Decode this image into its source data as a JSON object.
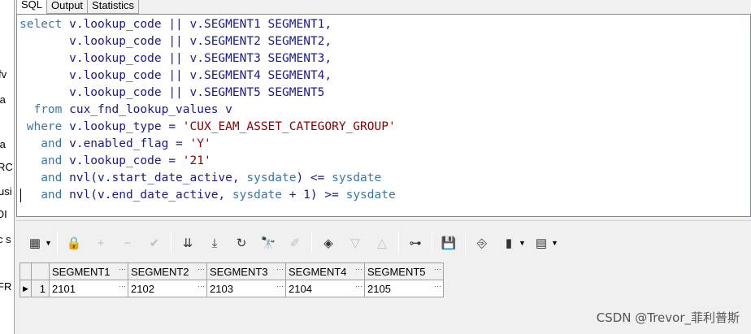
{
  "tabs": [
    {
      "label": "SQL",
      "active": true
    },
    {
      "label": "Output",
      "active": false
    },
    {
      "label": "Statistics",
      "active": false
    }
  ],
  "left_fragments": [
    "fv",
    "ta",
    "ta",
    "RC",
    "usi",
    "OI",
    "c s",
    "FR"
  ],
  "sql": {
    "lines": [
      [
        {
          "t": "select ",
          "c": "kw"
        },
        {
          "t": "v.lookup_code || v.SEGMENT1 SEGMENT1,",
          "c": "id"
        }
      ],
      [
        {
          "t": "       v.lookup_code || v.SEGMENT2 SEGMENT2,",
          "c": "id"
        }
      ],
      [
        {
          "t": "       v.lookup_code || v.SEGMENT3 SEGMENT3,",
          "c": "id"
        }
      ],
      [
        {
          "t": "       v.lookup_code || v.SEGMENT4 SEGMENT4,",
          "c": "id"
        }
      ],
      [
        {
          "t": "       v.lookup_code || v.SEGMENT5 SEGMENT5",
          "c": "id"
        }
      ],
      [
        {
          "t": "  from ",
          "c": "kw"
        },
        {
          "t": "cux_fnd_lookup_values v",
          "c": "id"
        }
      ],
      [
        {
          "t": " where ",
          "c": "kw"
        },
        {
          "t": "v.lookup_type = ",
          "c": "id"
        },
        {
          "t": "'CUX_EAM_ASSET_CATEGORY_GROUP'",
          "c": "str"
        }
      ],
      [
        {
          "t": "   and ",
          "c": "kw"
        },
        {
          "t": "v.enabled_flag = ",
          "c": "id"
        },
        {
          "t": "'Y'",
          "c": "str"
        }
      ],
      [
        {
          "t": "   and ",
          "c": "kw"
        },
        {
          "t": "v.lookup_code = ",
          "c": "id"
        },
        {
          "t": "'21'",
          "c": "str"
        }
      ],
      [
        {
          "t": "   and ",
          "c": "kw"
        },
        {
          "t": "nvl(v.start_date_active, ",
          "c": "id"
        },
        {
          "t": "sysdate",
          "c": "kw"
        },
        {
          "t": ") <= ",
          "c": "id"
        },
        {
          "t": "sysdate",
          "c": "kw"
        }
      ],
      [
        {
          "t": "   and ",
          "c": "kw"
        },
        {
          "t": "nvl(v.end_date_active, ",
          "c": "id"
        },
        {
          "t": "sysdate",
          "c": "kw"
        },
        {
          "t": " + 1) >= ",
          "c": "id"
        },
        {
          "t": "sysdate",
          "c": "kw"
        }
      ]
    ]
  },
  "toolbar": {
    "icons": [
      {
        "name": "grid-view-icon",
        "glyph": "▦",
        "disabled": false,
        "caret": true
      },
      {
        "sep": true
      },
      {
        "name": "lock-icon",
        "glyph": "🔒",
        "disabled": false
      },
      {
        "name": "add-row-icon",
        "glyph": "+",
        "disabled": true
      },
      {
        "name": "delete-row-icon",
        "glyph": "−",
        "disabled": true
      },
      {
        "name": "post-changes-icon",
        "glyph": "✔",
        "disabled": true
      },
      {
        "sep": true
      },
      {
        "name": "fetch-next-icon",
        "glyph": "⇊",
        "disabled": false
      },
      {
        "name": "fetch-last-icon",
        "glyph": "⤓",
        "disabled": false
      },
      {
        "name": "refresh-icon",
        "glyph": "↻",
        "disabled": false
      },
      {
        "name": "binoculars-icon",
        "glyph": "🔭",
        "disabled": false
      },
      {
        "name": "eraser-icon",
        "glyph": "✐",
        "disabled": true
      },
      {
        "sep": true
      },
      {
        "name": "query-by-example-icon",
        "glyph": "◈",
        "disabled": false
      },
      {
        "name": "sort-down-icon",
        "glyph": "▽",
        "disabled": true
      },
      {
        "name": "sort-up-icon",
        "glyph": "△",
        "disabled": true
      },
      {
        "sep": true
      },
      {
        "name": "tree-icon",
        "glyph": "⊶",
        "disabled": false
      },
      {
        "sep": true
      },
      {
        "name": "save-icon",
        "glyph": "💾",
        "disabled": false
      },
      {
        "sep": true
      },
      {
        "name": "export-icon",
        "glyph": "⎆",
        "disabled": false
      },
      {
        "name": "chart-icon",
        "glyph": "▮",
        "disabled": false,
        "caret": true
      },
      {
        "name": "table-export-icon",
        "glyph": "▤",
        "disabled": false,
        "caret": true
      }
    ]
  },
  "grid": {
    "columns": [
      "SEGMENT1",
      "SEGMENT2",
      "SEGMENT3",
      "SEGMENT4",
      "SEGMENT5"
    ],
    "rows": [
      {
        "num": "1",
        "cells": [
          "2101",
          "2102",
          "2103",
          "2104",
          "2105"
        ]
      }
    ]
  },
  "watermark": "CSDN @Trevor_菲利普斯"
}
